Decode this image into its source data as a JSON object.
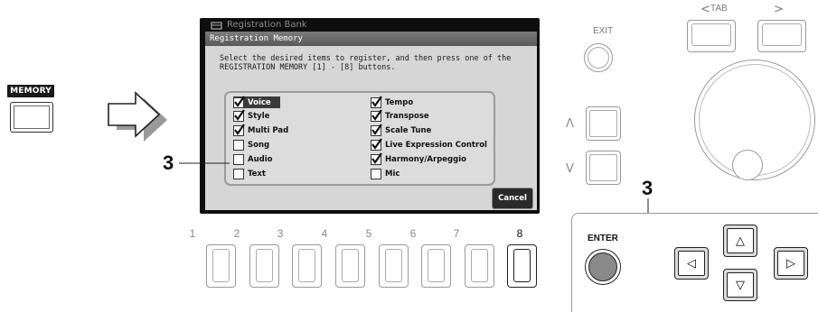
{
  "memory_button": {
    "label": "MEMORY"
  },
  "screen": {
    "behind_title": "Registration Bank",
    "dialog_title": "Registration Memory",
    "instruction_line1": "Select the desired items to register, and then press one of the",
    "instruction_line2": "REGISTRATION MEMORY [1] - [8] buttons.",
    "items_left": [
      {
        "label": "Voice",
        "checked": true,
        "highlighted": true
      },
      {
        "label": "Style",
        "checked": true,
        "highlighted": false
      },
      {
        "label": "Multi Pad",
        "checked": true,
        "highlighted": false
      },
      {
        "label": "Song",
        "checked": false,
        "highlighted": false
      },
      {
        "label": "Audio",
        "checked": false,
        "highlighted": false
      },
      {
        "label": "Text",
        "checked": false,
        "highlighted": false
      }
    ],
    "items_right": [
      {
        "label": "Tempo",
        "checked": true
      },
      {
        "label": "Transpose",
        "checked": true
      },
      {
        "label": "Scale Tune",
        "checked": true
      },
      {
        "label": "Live Expression Control",
        "checked": true
      },
      {
        "label": "Harmony/Arpeggio",
        "checked": true
      },
      {
        "label": "Mic",
        "checked": false
      }
    ],
    "cancel_label": "Cancel"
  },
  "callouts": {
    "left": "3",
    "right": "3"
  },
  "number_buttons": {
    "labels": [
      "1",
      "2",
      "3",
      "4",
      "5",
      "6",
      "7",
      "8"
    ],
    "active": "8"
  },
  "panel": {
    "exit_label": "EXIT",
    "tab_label": "TAB",
    "tab_left_arrow": "<",
    "tab_right_arrow": ">",
    "up_label": "Λ",
    "down_label": "V",
    "enter_label": "ENTER",
    "cursor_up": "△",
    "cursor_down": "▽",
    "cursor_left": "◁",
    "cursor_right": "▷"
  }
}
